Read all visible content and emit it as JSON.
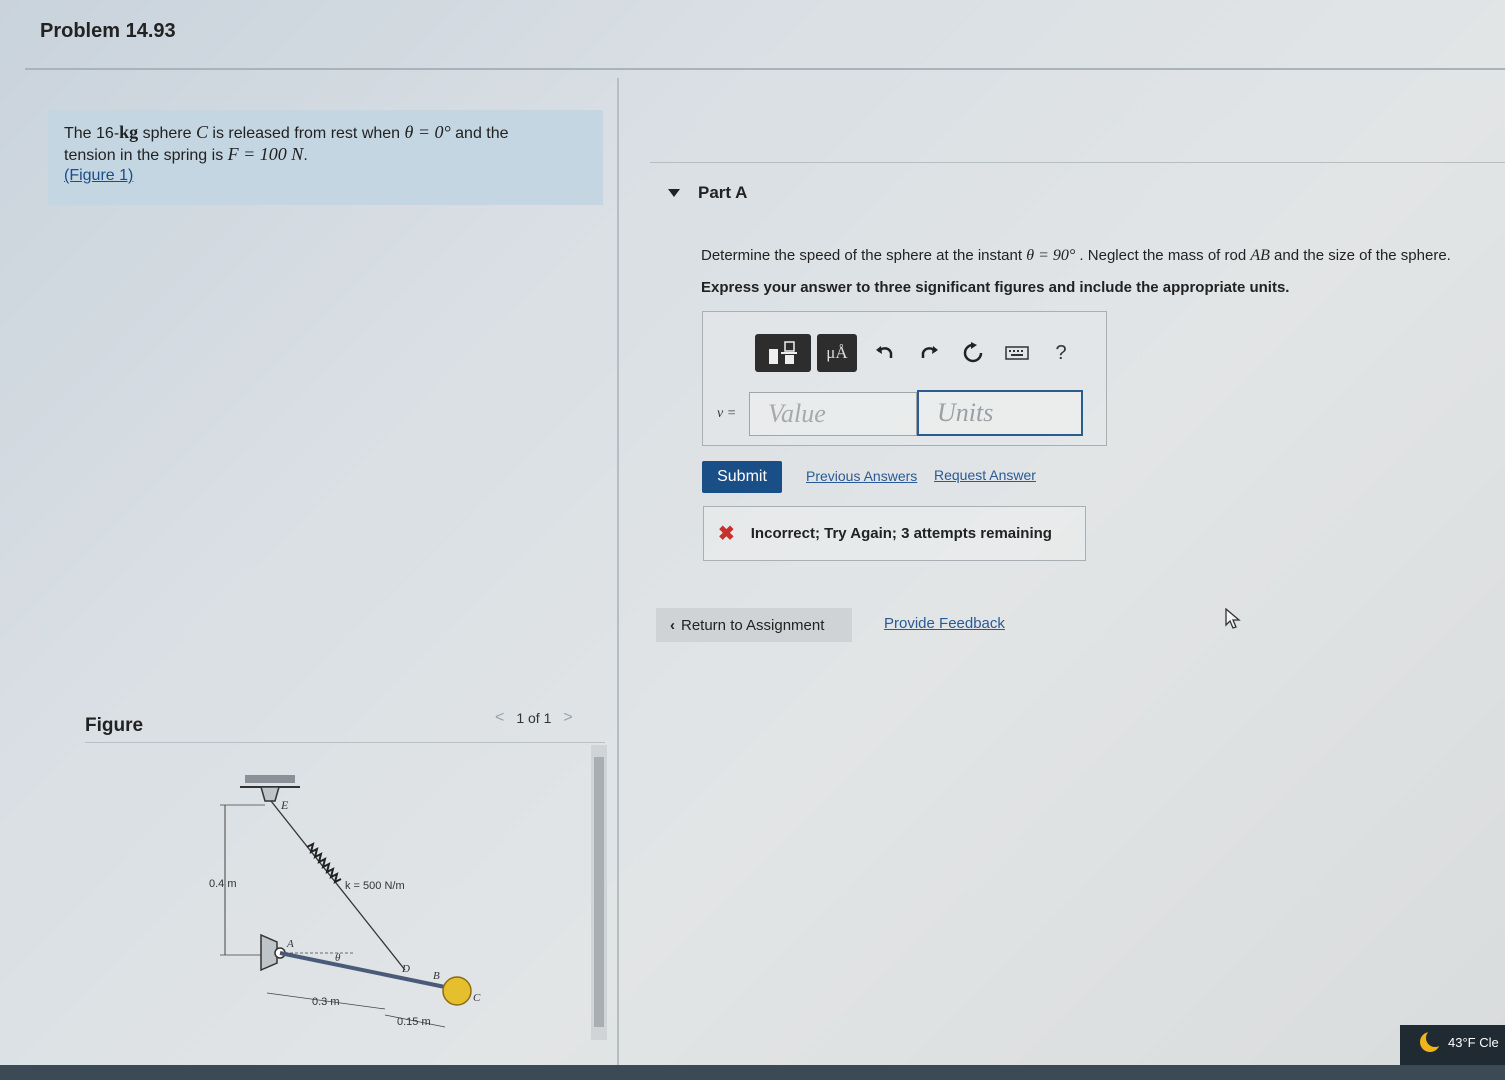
{
  "problem": {
    "title": "Problem 14.93",
    "statement_line1_a": "The 16-",
    "mass_unit": "kg",
    "statement_line1_b": " sphere ",
    "sphere_label": "C",
    "statement_line1_c": " is released from rest when ",
    "theta0": "θ = 0°",
    "statement_line1_d": " and the",
    "statement_line2_a": "tension in the spring is ",
    "force": "F = 100 N",
    "statement_line2_b": ".",
    "figure_link": "(Figure 1)"
  },
  "figure": {
    "header": "Figure",
    "pager_prev": "<",
    "pager_text": "1 of 1",
    "pager_next": ">",
    "labels": {
      "E": "E",
      "A": "A",
      "B": "B",
      "C": "C",
      "D": "D",
      "theta": "θ",
      "height": "0.4 m",
      "spring_k": "k = 500 N/m",
      "len_ad": "0.3 m",
      "len_db": "0.15 m"
    }
  },
  "part_a": {
    "label": "Part A",
    "question_a": "Determine the speed of the sphere at the instant ",
    "theta90": "θ = 90°",
    "question_b": " . Neglect the mass of rod ",
    "rod": "AB",
    "question_c": " and the size of the sphere.",
    "instruction": "Express your answer to three significant figures and include the appropriate units.",
    "toolbar": {
      "mu_label": "μÅ",
      "help": "?"
    },
    "variable_label": "v =",
    "value_placeholder": "Value",
    "units_placeholder": "Units",
    "submit_label": "Submit",
    "previous_answers": "Previous Answers",
    "request_answer": "Request Answer",
    "feedback": "Incorrect; Try Again; 3 attempts remaining"
  },
  "footer": {
    "return_label": "Return to Assignment",
    "provide_feedback": "Provide Feedback"
  },
  "taskbar": {
    "weather": "43°F Cle"
  },
  "colors": {
    "submit": "#1a4e86",
    "statement_bg": "#c4d6e2",
    "error": "#c9302c",
    "link": "#2a5a94"
  }
}
